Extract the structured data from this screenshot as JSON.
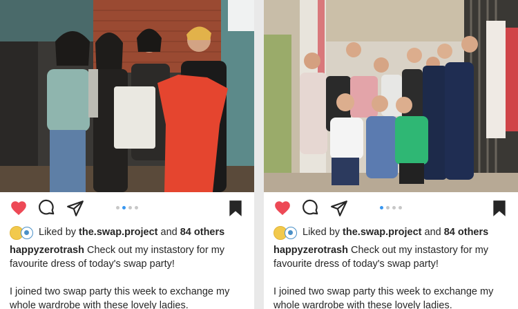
{
  "colors": {
    "like_red": "#ed4956",
    "dot_active": "#3897f0",
    "dot_inactive": "#c7c7c7",
    "text": "#262626"
  },
  "posts": [
    {
      "likes": {
        "prefix": "Liked by",
        "user": "the.swap.project",
        "and": "and",
        "others": "84 others"
      },
      "caption": {
        "username": "happyzerotrash",
        "text": "Check out my instastory for my favourite dress of today's swap party!",
        "extra": "I joined two swap party this week to exchange my whole wardrobe with these lovely ladies."
      },
      "carousel": {
        "count": 4,
        "active": 1
      },
      "icons": [
        "heart-icon",
        "comment-icon",
        "share-icon",
        "bookmark-icon"
      ]
    },
    {
      "likes": {
        "prefix": "Liked by",
        "user": "the.swap.project",
        "and": "and",
        "others": "84 others"
      },
      "caption": {
        "username": "happyzerotrash",
        "text": "Check out my instastory for my favourite dress of today's swap party!",
        "extra": "I joined two swap party this week to exchange my whole wardrobe with these lovely ladies."
      },
      "carousel": {
        "count": 4,
        "active": 0
      },
      "icons": [
        "heart-icon",
        "comment-icon",
        "share-icon",
        "bookmark-icon"
      ]
    }
  ]
}
